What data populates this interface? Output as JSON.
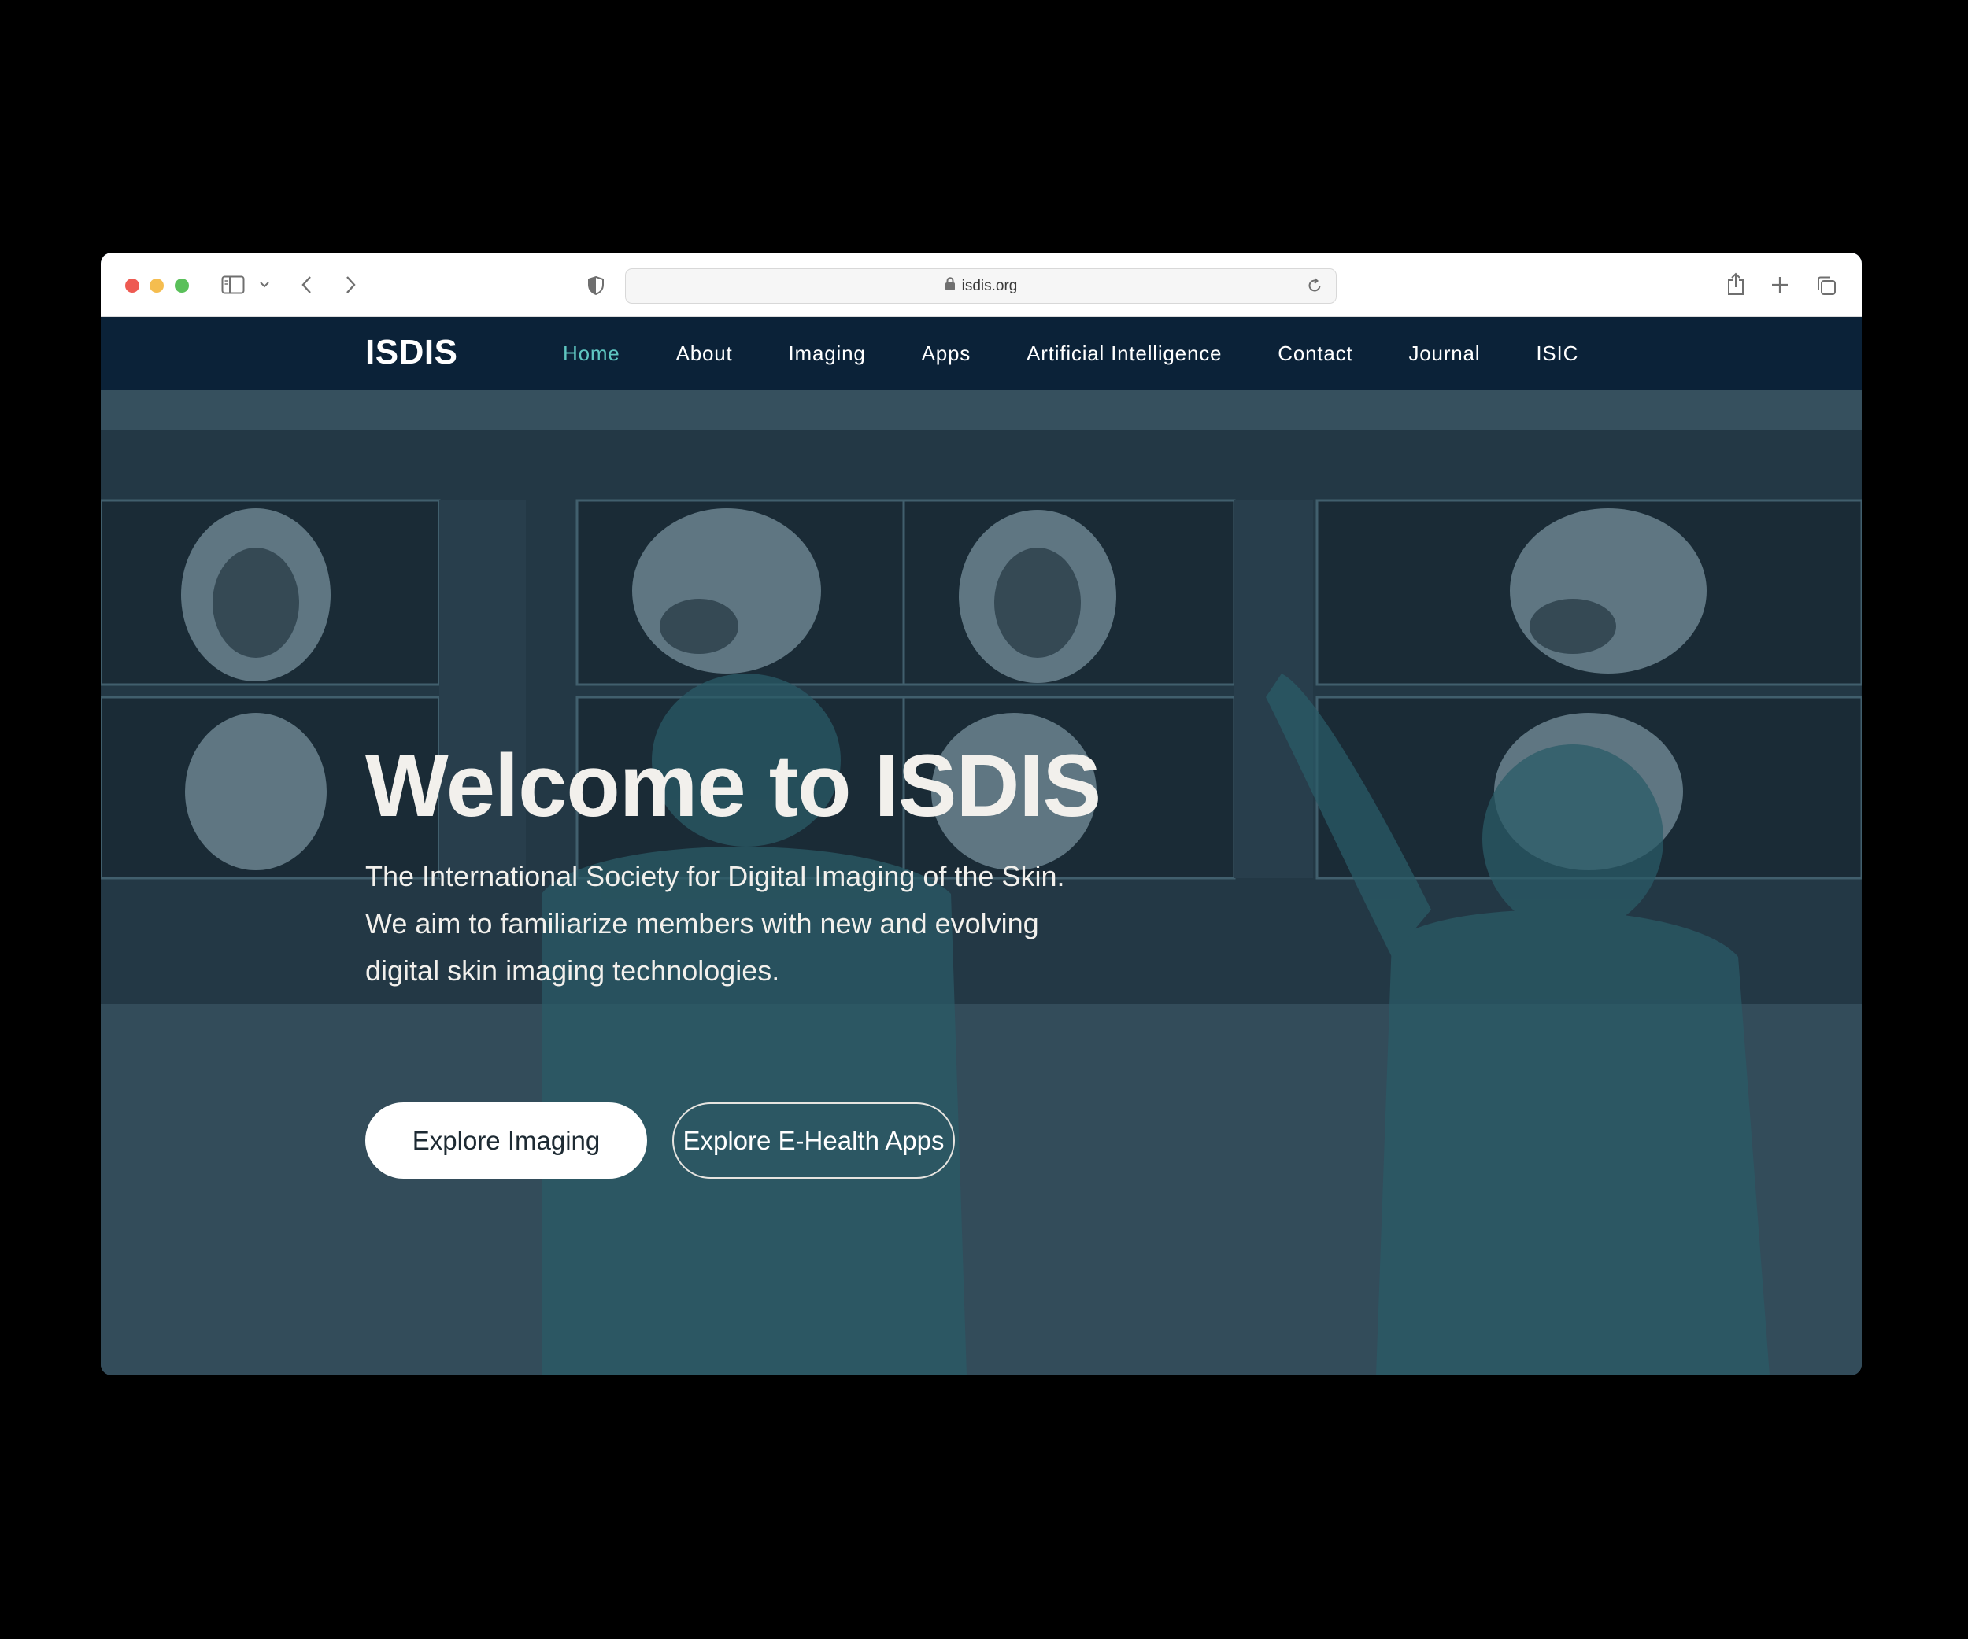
{
  "browser": {
    "url": "isdis.org",
    "icons": [
      "sidebar-icon",
      "chevron-down-icon",
      "back-arrow-icon",
      "forward-arrow-icon",
      "shield-icon",
      "lock-icon",
      "reload-icon",
      "share-icon",
      "plus-icon",
      "tabs-icon"
    ]
  },
  "navbar": {
    "logo": "ISDIS",
    "links": [
      "Home",
      "About",
      "Imaging",
      "Apps",
      "Artificial Intelligence",
      "Contact",
      "Journal",
      "ISIC"
    ],
    "active_index": 0,
    "active_color": "#5fc7c1",
    "background": "#0b2238"
  },
  "hero": {
    "title": "Welcome to ISDIS",
    "description_lines": [
      "The International Society for Digital Imaging of the Skin.",
      "We aim to familiarize members with new and evolving",
      "digital skin imaging technologies."
    ],
    "primary_button": "Explore Imaging",
    "secondary_button": "Explore E-Health Apps"
  }
}
